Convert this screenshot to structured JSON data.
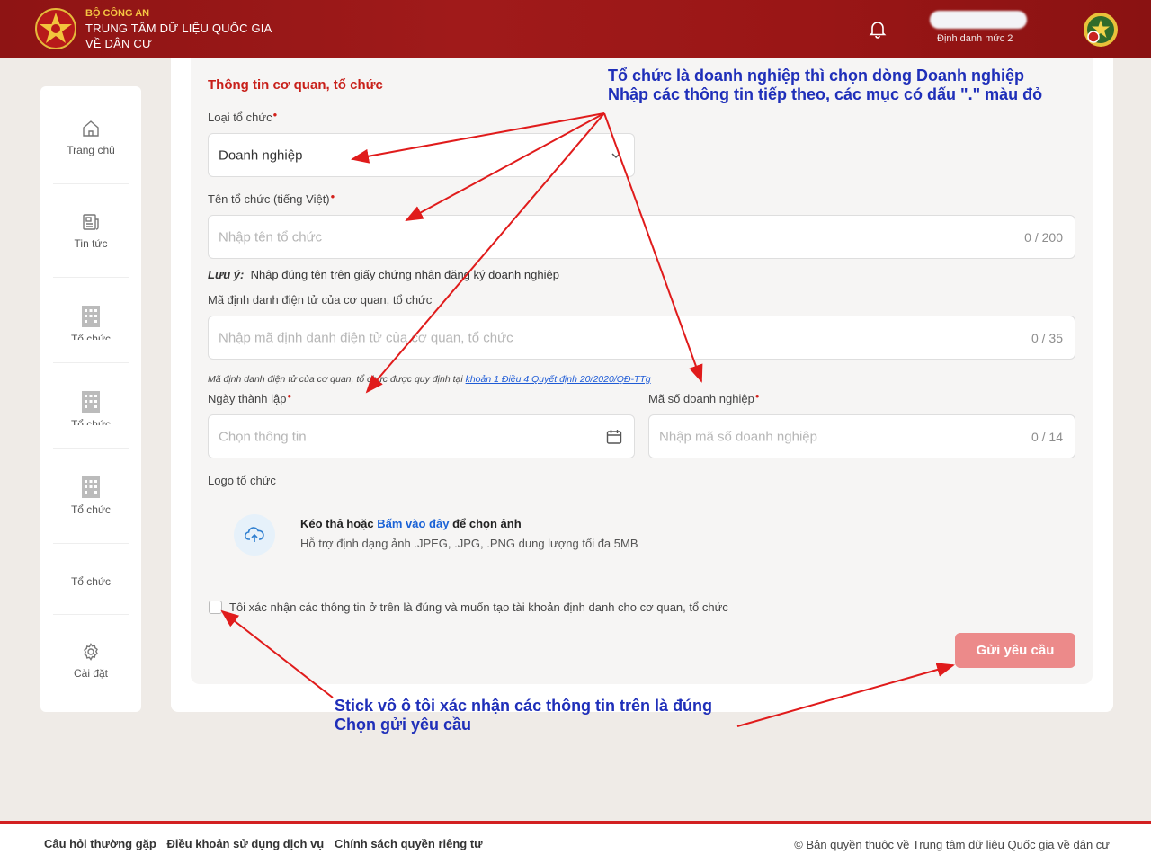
{
  "header": {
    "org_line1": "BỘ CÔNG AN",
    "org_line2": "TRUNG TÂM DỮ LIỆU QUỐC GIA",
    "org_line3": "VỀ DÂN CƯ",
    "user_level": "Định danh mức 2",
    "logo_icon": "police-star-emblem-icon",
    "bell_icon": "bell-icon",
    "avatar_icon": "avatar-emblem-icon"
  },
  "sidebar": {
    "items": [
      {
        "label": "Trang chủ",
        "icon": "home-icon"
      },
      {
        "label": "Tin tức",
        "icon": "news-icon"
      },
      {
        "label": "Tổ chức",
        "icon": "building-icon"
      },
      {
        "label": "Tổ chức",
        "icon": "building-icon"
      },
      {
        "label": "Tổ chức",
        "icon": "building-icon"
      },
      {
        "label": "Tổ chức",
        "icon": ""
      },
      {
        "label": "Cài đặt",
        "icon": "gear-icon"
      }
    ]
  },
  "form": {
    "section_title": "Thông tin cơ quan, tổ chức",
    "org_type_label": "Loại tổ chức",
    "org_type_value": "Doanh nghiệp",
    "org_name_label": "Tên tổ chức (tiếng Việt)",
    "org_name_placeholder": "Nhập tên tổ chức",
    "org_name_count": "0 / 200",
    "note_prefix": "Lưu ý:",
    "note_text": "Nhập đúng tên trên giấy chứng nhận đăng ký doanh nghiệp",
    "eid_label": "Mã định danh điện tử của cơ quan, tổ chức",
    "eid_placeholder": "Nhập mã định danh điện tử của cơ quan, tổ chức",
    "eid_count": "0 / 35",
    "eid_note": "Mã định danh điện tử của cơ quan, tổ chức được quy định tại",
    "eid_note_link": "khoản 1 Điều 4 Quyết định 20/2020/QĐ-TTg",
    "founded_label": "Ngày thành lập",
    "founded_placeholder": "Chọn thông tin",
    "tax_label": "Mã số doanh nghiệp",
    "tax_placeholder": "Nhập mã số doanh nghiệp",
    "tax_count": "0 / 14",
    "logo_label": "Logo tổ chức",
    "upload_prefix": "Kéo thả hoặc",
    "upload_link": "Bấm vào đây",
    "upload_suffix": "để chọn ảnh",
    "upload_hint": "Hỗ trợ định dạng ảnh .JPEG, .JPG, .PNG dung lượng tối đa 5MB",
    "confirm_label": "Tôi xác nhận các thông tin ở trên là đúng và muốn tạo tài khoản định danh cho cơ quan, tổ chức",
    "submit_label": "Gửi yêu cầu"
  },
  "annotations": {
    "top_line1": "Tổ chức là doanh nghiệp thì chọn dòng Doanh nghiệp",
    "top_line2": "Nhập các thông tin tiếp theo, các mục có dấu \".\" màu đỏ",
    "bottom_line1": "Stick vô ô tôi xác nhận các thông tin trên là đúng",
    "bottom_line2": "Chọn gửi yêu cầu",
    "arrow_color": "#e01b1b"
  },
  "footer": {
    "link1": "Câu hỏi thường gặp",
    "link2": "Điều khoản sử dụng dịch vụ",
    "link3": "Chính sách quyền riêng tư",
    "copyright": "© Bản quyền thuộc về Trung tâm dữ liệu Quốc gia về dân cư"
  },
  "colors": {
    "header_red": "#9a1616",
    "accent_red": "#c8201a",
    "submit_pink": "#ec8a8a",
    "link_blue": "#1a62d6",
    "annotation_blue": "#1f2fb9"
  }
}
